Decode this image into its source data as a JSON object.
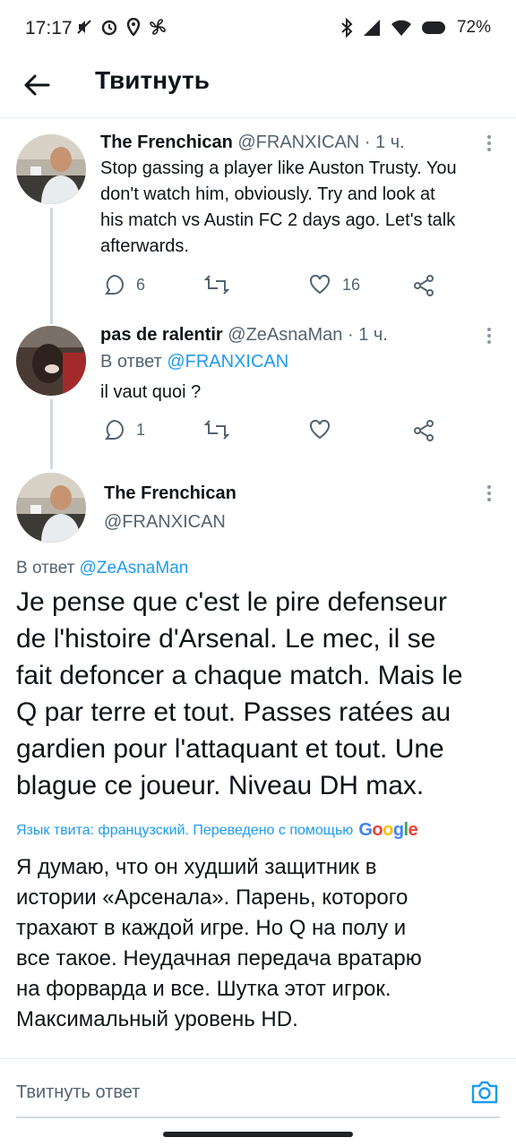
{
  "status_bar": {
    "time": "17:17",
    "battery": "72%",
    "icons_left": [
      "mute-icon",
      "alarm-icon",
      "location-icon",
      "fan-icon"
    ],
    "icons_right": [
      "bluetooth-icon",
      "signal-icon",
      "wifi-icon",
      "battery-icon"
    ]
  },
  "header": {
    "title": "Твитнуть"
  },
  "tweets": [
    {
      "name": "The Frenchican",
      "handle": "@FRANXICAN",
      "time": "· 1 ч.",
      "text_lines": [
        "Stop gassing a player like Auston Trusty. You",
        "don't watch him, obviously. Try and look at",
        "his match vs Austin FC 2 days ago. Let's talk",
        "afterwards."
      ],
      "replies": "6",
      "retweets": "",
      "likes": "16"
    },
    {
      "name": "pas de ralentir",
      "handle": "@ZeAsnaMan",
      "time": "· 1 ч.",
      "reply_prefix": "В ответ",
      "reply_to": "@FRANXICAN",
      "text_lines": [
        "il vaut quoi ?"
      ],
      "replies": "1",
      "retweets": "",
      "likes": ""
    }
  ],
  "main_tweet": {
    "name": "The Frenchican",
    "handle": "@FRANXICAN",
    "reply_prefix": "В ответ",
    "reply_to": "@ZeAsnaMan",
    "text_lines": [
      "Je pense que c'est le pire defenseur",
      "de l'histoire d'Arsenal. Le mec, il se",
      "fait defoncer a chaque match. Mais le",
      "Q par terre et tout. Passes ratées au",
      "gardien pour l'attaquant et tout. Une",
      "blague ce joueur. Niveau DH max."
    ],
    "translation_note": "Язык твита: французский. Переведено с помощью",
    "translation_brand": "Google",
    "translated_lines": [
      "Я думаю, что он худший защитник в",
      "истории «Арсенала». Парень, которого",
      "трахают в каждой игре. Но Q на полу и",
      "все такое. Неудачная передача вратарю",
      "на форварда и все. Шутка этот игрок.",
      "Максимальный уровень HD."
    ]
  },
  "reply_bar": {
    "placeholder": "Твитнуть ответ"
  },
  "colors": {
    "link": "#1d9bf0",
    "secondary_text": "#536471",
    "divider": "#e6ecf0"
  }
}
